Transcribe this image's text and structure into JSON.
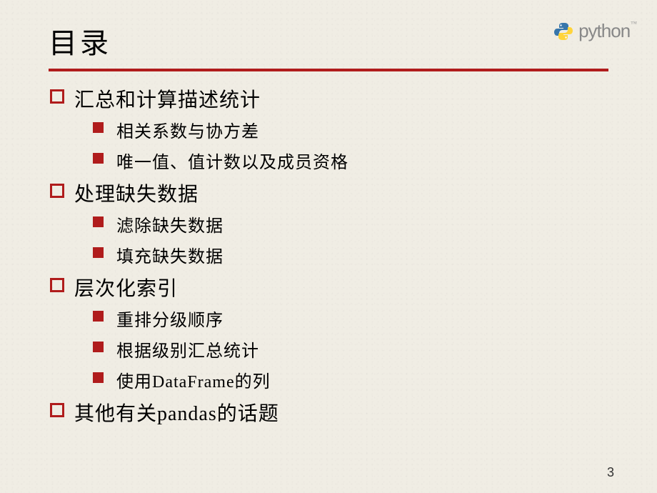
{
  "logo": {
    "text": "python",
    "tm": "™"
  },
  "title": "目录",
  "sections": [
    {
      "label": "汇总和计算描述统计",
      "items": [
        "相关系数与协方差",
        "唯一值、值计数以及成员资格"
      ]
    },
    {
      "label": "处理缺失数据",
      "items": [
        "滤除缺失数据",
        "填充缺失数据"
      ]
    },
    {
      "label": "层次化索引",
      "items": [
        "重排分级顺序",
        "根据级别汇总统计",
        "使用DataFrame的列"
      ]
    },
    {
      "label": "其他有关pandas的话题",
      "items": []
    }
  ],
  "page_number": "3"
}
